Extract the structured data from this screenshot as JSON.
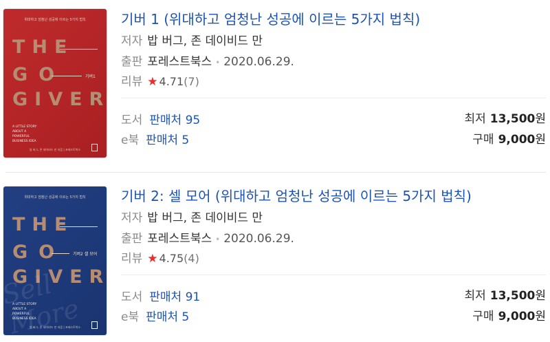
{
  "results": [
    {
      "title": "기버 1 (위대하고 엄청난 성공에 이르는 5가지 법칙)",
      "author_label": "저자",
      "author": "밥 버그, 존 데이비드 만",
      "publisher_label": "출판",
      "publisher": "포레스트북스",
      "date": "2020.06.29.",
      "review_label": "리뷰",
      "rating": "4.71",
      "review_count": "(7)",
      "book_kind": "도서",
      "book_sellers": "판매처 95",
      "ebook_kind": "e북",
      "ebook_sellers": "판매처 5",
      "lowest_label": "최저",
      "lowest_price": "13,500",
      "buy_label": "구매",
      "buy_price": "9,000",
      "currency": "원",
      "cover": {
        "top_text": "위대하고 엄청난 성공에 이르는 5가지 법칙",
        "word1": "THE",
        "word2": "GO",
        "word3": "GIVER",
        "subtitle": "기버1",
        "story": "A LITTLE STORY\nABOUT A\nPOWERFUL\nBUSINESS IDEA",
        "bottom_text": "밥 버그, 존 데이비드 만 지음 | 포레스트북스"
      }
    },
    {
      "title": "기버 2: 셀 모어 (위대하고 엄청난 성공에 이르는 5가지 법칙)",
      "author_label": "저자",
      "author": "밥 버그, 존 데이비드 만",
      "publisher_label": "출판",
      "publisher": "포레스트북스",
      "date": "2020.06.29.",
      "review_label": "리뷰",
      "rating": "4.75",
      "review_count": "(4)",
      "book_kind": "도서",
      "book_sellers": "판매처 91",
      "ebook_kind": "e북",
      "ebook_sellers": "판매처 5",
      "lowest_label": "최저",
      "lowest_price": "13,500",
      "buy_label": "구매",
      "buy_price": "9,000",
      "currency": "원",
      "cover": {
        "top_text": "위대하고 엄청난 성공에 이르는 5가지 법칙",
        "word1": "THE",
        "word2": "GO",
        "word3": "GIVER",
        "subtitle": "기버2 셀 모어",
        "script": "Sell More",
        "story": "A LITTLE STORY\nABOUT A\nPOWERFUL\nBUSINESS IDEA",
        "bottom_text": "밥 버그, 존 데이비드 만 지음 | 포레스트북스"
      }
    }
  ],
  "colors": {
    "link": "#1d53b5",
    "star": "#ee2a2a",
    "cover1": "#b52528",
    "cover2": "#1e3a78",
    "cover_text": "#b68c73"
  }
}
